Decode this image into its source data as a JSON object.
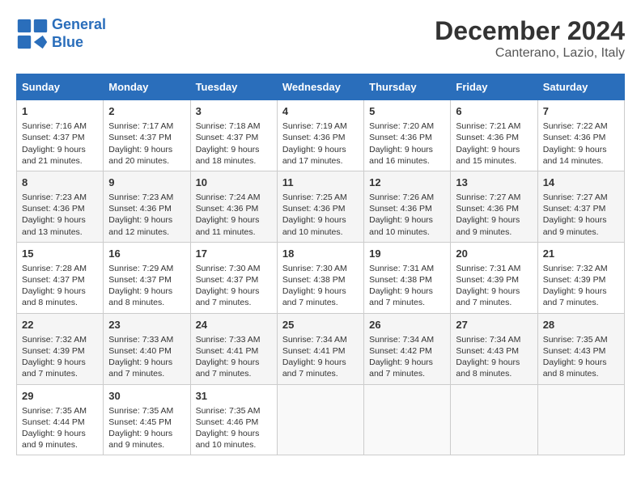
{
  "header": {
    "logo_line1": "General",
    "logo_line2": "Blue",
    "month_year": "December 2024",
    "location": "Canterano, Lazio, Italy"
  },
  "columns": [
    "Sunday",
    "Monday",
    "Tuesday",
    "Wednesday",
    "Thursday",
    "Friday",
    "Saturday"
  ],
  "weeks": [
    [
      {
        "day": "1",
        "sunrise": "Sunrise: 7:16 AM",
        "sunset": "Sunset: 4:37 PM",
        "daylight": "Daylight: 9 hours and 21 minutes."
      },
      {
        "day": "2",
        "sunrise": "Sunrise: 7:17 AM",
        "sunset": "Sunset: 4:37 PM",
        "daylight": "Daylight: 9 hours and 20 minutes."
      },
      {
        "day": "3",
        "sunrise": "Sunrise: 7:18 AM",
        "sunset": "Sunset: 4:37 PM",
        "daylight": "Daylight: 9 hours and 18 minutes."
      },
      {
        "day": "4",
        "sunrise": "Sunrise: 7:19 AM",
        "sunset": "Sunset: 4:36 PM",
        "daylight": "Daylight: 9 hours and 17 minutes."
      },
      {
        "day": "5",
        "sunrise": "Sunrise: 7:20 AM",
        "sunset": "Sunset: 4:36 PM",
        "daylight": "Daylight: 9 hours and 16 minutes."
      },
      {
        "day": "6",
        "sunrise": "Sunrise: 7:21 AM",
        "sunset": "Sunset: 4:36 PM",
        "daylight": "Daylight: 9 hours and 15 minutes."
      },
      {
        "day": "7",
        "sunrise": "Sunrise: 7:22 AM",
        "sunset": "Sunset: 4:36 PM",
        "daylight": "Daylight: 9 hours and 14 minutes."
      }
    ],
    [
      {
        "day": "8",
        "sunrise": "Sunrise: 7:23 AM",
        "sunset": "Sunset: 4:36 PM",
        "daylight": "Daylight: 9 hours and 13 minutes."
      },
      {
        "day": "9",
        "sunrise": "Sunrise: 7:23 AM",
        "sunset": "Sunset: 4:36 PM",
        "daylight": "Daylight: 9 hours and 12 minutes."
      },
      {
        "day": "10",
        "sunrise": "Sunrise: 7:24 AM",
        "sunset": "Sunset: 4:36 PM",
        "daylight": "Daylight: 9 hours and 11 minutes."
      },
      {
        "day": "11",
        "sunrise": "Sunrise: 7:25 AM",
        "sunset": "Sunset: 4:36 PM",
        "daylight": "Daylight: 9 hours and 10 minutes."
      },
      {
        "day": "12",
        "sunrise": "Sunrise: 7:26 AM",
        "sunset": "Sunset: 4:36 PM",
        "daylight": "Daylight: 9 hours and 10 minutes."
      },
      {
        "day": "13",
        "sunrise": "Sunrise: 7:27 AM",
        "sunset": "Sunset: 4:36 PM",
        "daylight": "Daylight: 9 hours and 9 minutes."
      },
      {
        "day": "14",
        "sunrise": "Sunrise: 7:27 AM",
        "sunset": "Sunset: 4:37 PM",
        "daylight": "Daylight: 9 hours and 9 minutes."
      }
    ],
    [
      {
        "day": "15",
        "sunrise": "Sunrise: 7:28 AM",
        "sunset": "Sunset: 4:37 PM",
        "daylight": "Daylight: 9 hours and 8 minutes."
      },
      {
        "day": "16",
        "sunrise": "Sunrise: 7:29 AM",
        "sunset": "Sunset: 4:37 PM",
        "daylight": "Daylight: 9 hours and 8 minutes."
      },
      {
        "day": "17",
        "sunrise": "Sunrise: 7:30 AM",
        "sunset": "Sunset: 4:37 PM",
        "daylight": "Daylight: 9 hours and 7 minutes."
      },
      {
        "day": "18",
        "sunrise": "Sunrise: 7:30 AM",
        "sunset": "Sunset: 4:38 PM",
        "daylight": "Daylight: 9 hours and 7 minutes."
      },
      {
        "day": "19",
        "sunrise": "Sunrise: 7:31 AM",
        "sunset": "Sunset: 4:38 PM",
        "daylight": "Daylight: 9 hours and 7 minutes."
      },
      {
        "day": "20",
        "sunrise": "Sunrise: 7:31 AM",
        "sunset": "Sunset: 4:39 PM",
        "daylight": "Daylight: 9 hours and 7 minutes."
      },
      {
        "day": "21",
        "sunrise": "Sunrise: 7:32 AM",
        "sunset": "Sunset: 4:39 PM",
        "daylight": "Daylight: 9 hours and 7 minutes."
      }
    ],
    [
      {
        "day": "22",
        "sunrise": "Sunrise: 7:32 AM",
        "sunset": "Sunset: 4:39 PM",
        "daylight": "Daylight: 9 hours and 7 minutes."
      },
      {
        "day": "23",
        "sunrise": "Sunrise: 7:33 AM",
        "sunset": "Sunset: 4:40 PM",
        "daylight": "Daylight: 9 hours and 7 minutes."
      },
      {
        "day": "24",
        "sunrise": "Sunrise: 7:33 AM",
        "sunset": "Sunset: 4:41 PM",
        "daylight": "Daylight: 9 hours and 7 minutes."
      },
      {
        "day": "25",
        "sunrise": "Sunrise: 7:34 AM",
        "sunset": "Sunset: 4:41 PM",
        "daylight": "Daylight: 9 hours and 7 minutes."
      },
      {
        "day": "26",
        "sunrise": "Sunrise: 7:34 AM",
        "sunset": "Sunset: 4:42 PM",
        "daylight": "Daylight: 9 hours and 7 minutes."
      },
      {
        "day": "27",
        "sunrise": "Sunrise: 7:34 AM",
        "sunset": "Sunset: 4:43 PM",
        "daylight": "Daylight: 9 hours and 8 minutes."
      },
      {
        "day": "28",
        "sunrise": "Sunrise: 7:35 AM",
        "sunset": "Sunset: 4:43 PM",
        "daylight": "Daylight: 9 hours and 8 minutes."
      }
    ],
    [
      {
        "day": "29",
        "sunrise": "Sunrise: 7:35 AM",
        "sunset": "Sunset: 4:44 PM",
        "daylight": "Daylight: 9 hours and 9 minutes."
      },
      {
        "day": "30",
        "sunrise": "Sunrise: 7:35 AM",
        "sunset": "Sunset: 4:45 PM",
        "daylight": "Daylight: 9 hours and 9 minutes."
      },
      {
        "day": "31",
        "sunrise": "Sunrise: 7:35 AM",
        "sunset": "Sunset: 4:46 PM",
        "daylight": "Daylight: 9 hours and 10 minutes."
      },
      null,
      null,
      null,
      null
    ]
  ]
}
